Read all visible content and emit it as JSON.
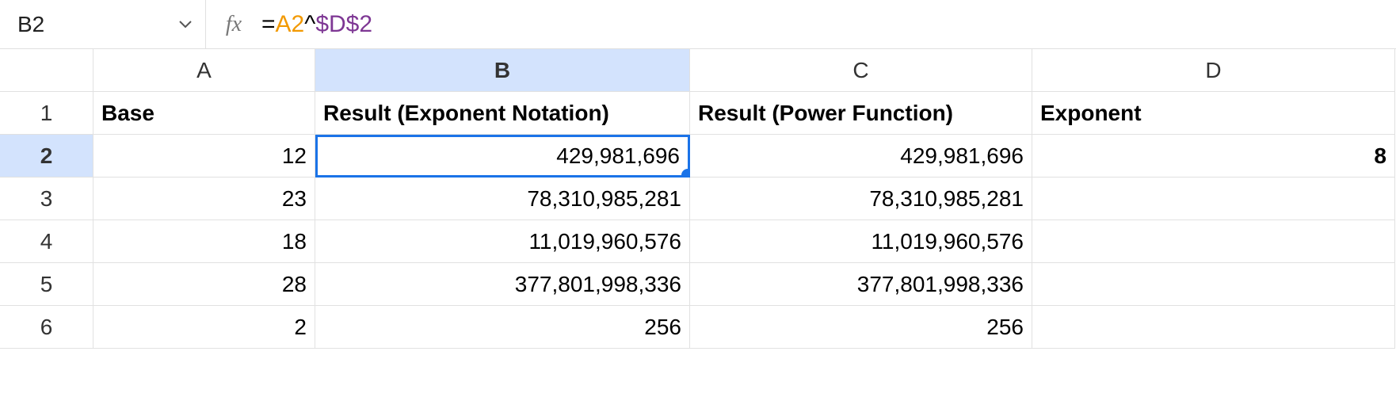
{
  "name_box": "B2",
  "formula": {
    "eq": "=",
    "ref1": "A2",
    "op": "^",
    "ref2": "$D$2"
  },
  "fx_label": "fx",
  "columns": [
    "A",
    "B",
    "C",
    "D"
  ],
  "row_headers": [
    "1",
    "2",
    "3",
    "4",
    "5",
    "6"
  ],
  "selected_cell": "B2",
  "selected_column": "B",
  "selected_row": "2",
  "headers": {
    "A": "Base",
    "B": "Result (Exponent Notation)",
    "C": "Result (Power Function)",
    "D": "Exponent"
  },
  "rows": [
    {
      "A": "12",
      "B": "429,981,696",
      "C": "429,981,696",
      "D": "8"
    },
    {
      "A": "23",
      "B": "78,310,985,281",
      "C": "78,310,985,281",
      "D": ""
    },
    {
      "A": "18",
      "B": "11,019,960,576",
      "C": "11,019,960,576",
      "D": ""
    },
    {
      "A": "28",
      "B": "377,801,998,336",
      "C": "377,801,998,336",
      "D": ""
    },
    {
      "A": "2",
      "B": "256",
      "C": "256",
      "D": ""
    }
  ]
}
